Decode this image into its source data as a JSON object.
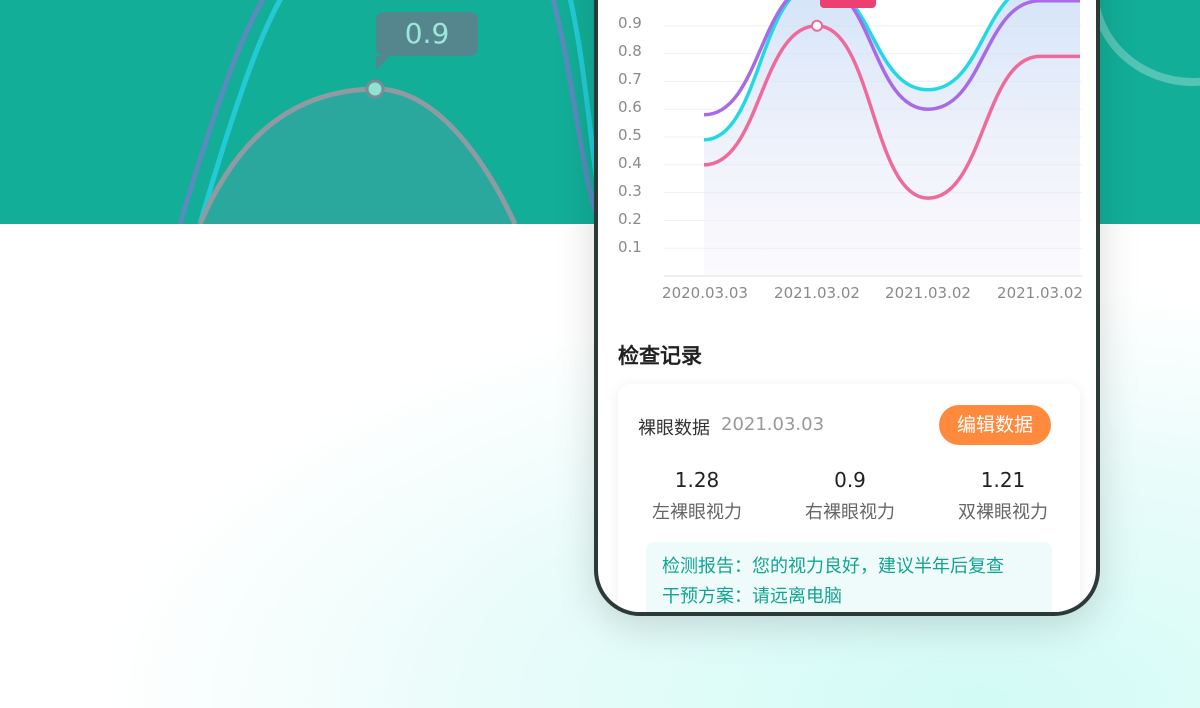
{
  "background_chart": {
    "tooltip_value": "0.9"
  },
  "chart_data": {
    "type": "line",
    "y_ticks": [
      "0.9",
      "0.8",
      "0.7",
      "0.6",
      "0.5",
      "0.4",
      "0.3",
      "0.2",
      "0.1"
    ],
    "x_ticks": [
      "2020.03.03",
      "2021.03.02",
      "2021.03.02",
      "2021.03.02"
    ],
    "ylim": [
      0,
      1.0
    ],
    "series": [
      {
        "color": "#22d8e6",
        "values": [
          0.49,
          1.05,
          0.67,
          1.05
        ]
      },
      {
        "color": "#a86ae6",
        "values": [
          0.58,
          1.05,
          0.6,
          0.99
        ]
      },
      {
        "color": "#ee6a9a",
        "values": [
          0.4,
          0.9,
          0.28,
          0.79
        ]
      }
    ],
    "highlight": {
      "series": 2,
      "value": 0.9,
      "label": "0.9"
    }
  },
  "records": {
    "title": "检查记录",
    "card": {
      "label": "裸眼数据",
      "date": "2021.03.03",
      "edit_label": "编辑数据",
      "stats": [
        {
          "value": "1.28",
          "label": "左裸眼视力"
        },
        {
          "value": "0.9",
          "label": "右裸眼视力"
        },
        {
          "value": "1.21",
          "label": "双裸眼视力"
        }
      ],
      "report_line": "检测报告：您的视力良好，建议半年后复查",
      "plan_line": "干预方案：请远离电脑"
    }
  },
  "colors": {
    "brand": "#12ae98",
    "accent": "#ff8a3d",
    "highlight": "#ee3f72"
  }
}
